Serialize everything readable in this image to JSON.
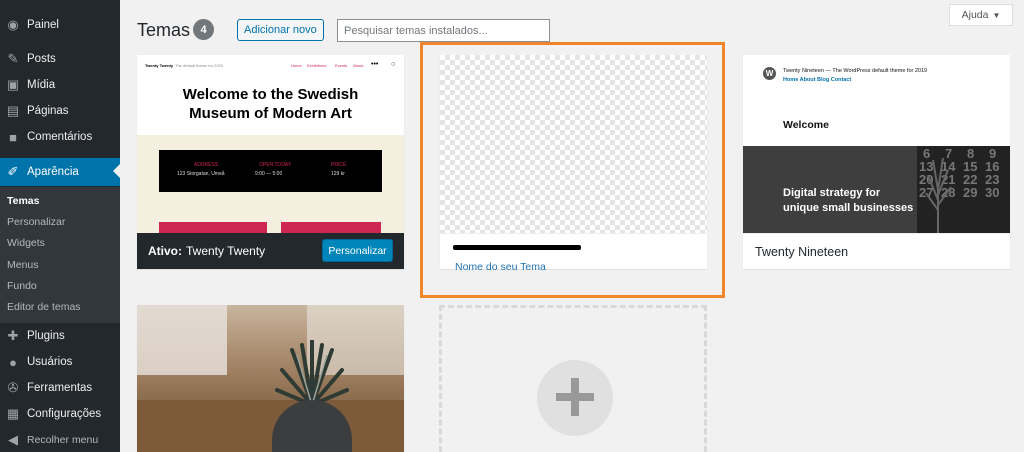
{
  "sidebar": {
    "items": [
      {
        "label": "Painel",
        "icon": "dashboard-icon",
        "glyph": "◉"
      },
      {
        "label": "Posts",
        "icon": "pin-icon",
        "glyph": "✎"
      },
      {
        "label": "Mídia",
        "icon": "media-icon",
        "glyph": "▣"
      },
      {
        "label": "Páginas",
        "icon": "pages-icon",
        "glyph": "▤"
      },
      {
        "label": "Comentários",
        "icon": "comments-icon",
        "glyph": "■"
      },
      {
        "label": "Aparência",
        "icon": "brush-icon",
        "glyph": "✐"
      },
      {
        "label": "Plugins",
        "icon": "plugin-icon",
        "glyph": "✚"
      },
      {
        "label": "Usuários",
        "icon": "user-icon",
        "glyph": "●"
      },
      {
        "label": "Ferramentas",
        "icon": "wrench-icon",
        "glyph": "✇"
      },
      {
        "label": "Configurações",
        "icon": "settings-icon",
        "glyph": "▦"
      },
      {
        "label": "Recolher menu",
        "icon": "collapse-icon",
        "glyph": "◀"
      }
    ],
    "submenu": [
      "Temas",
      "Personalizar",
      "Widgets",
      "Menus",
      "Fundo",
      "Editor de temas"
    ]
  },
  "header": {
    "title": "Temas",
    "count": "4",
    "add_new": "Adicionar novo",
    "search_placeholder": "Pesquisar temas instalados...",
    "help": "Ajuda",
    "help_caret": "▼"
  },
  "themes": {
    "twenty_twenty": {
      "active_prefix": "Ativo:",
      "name": "Twenty Twenty",
      "customize": "Personalizar",
      "preview_site": "Twenty Twenty",
      "preview_tagline": "The default theme for 2020",
      "preview_nav": [
        "Home",
        "Exhibitions",
        "Events",
        "About"
      ],
      "preview_heading_1": "Welcome to the Swedish",
      "preview_heading_2": "Museum of Modern Art",
      "preview_cells": [
        {
          "label": "ADDRESS",
          "value": "123 Storgatan, Umeå"
        },
        {
          "label": "OPEN TODAY",
          "value": "9:00 — 5:00"
        },
        {
          "label": "PRICE",
          "value": "129 kr"
        }
      ]
    },
    "custom": {
      "subtitle": "Nome do seu Tema"
    },
    "twenty_nineteen": {
      "name": "Twenty Nineteen",
      "preview_site": "Twenty Nineteen — The WordPress default theme for 2019",
      "preview_nav": "Home  About  Blog  Contact",
      "preview_welcome": "Welcome",
      "preview_strategy_1": "Digital strategy for",
      "preview_strategy_2": "unique small businesses",
      "calendar_numbers": [
        "6",
        "7",
        "8",
        "9",
        "13",
        "14",
        "15",
        "16",
        "20",
        "21",
        "22",
        "23",
        "27",
        "28",
        "29",
        "30"
      ]
    }
  },
  "colors": {
    "sidebar_bg": "#23282d",
    "active_menu": "#0073aa",
    "highlight_border": "#f0862c",
    "button_primary": "#0085ba"
  }
}
